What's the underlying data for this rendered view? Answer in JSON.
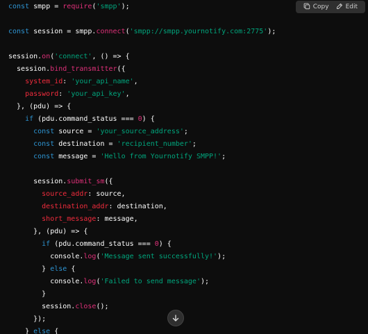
{
  "toolbar": {
    "copy_label": "Copy",
    "edit_label": "Edit"
  },
  "code_lines": [
    [
      [
        "kw",
        "const"
      ],
      [
        "pl",
        " smpp = "
      ],
      [
        "fn",
        "require"
      ],
      [
        "pl",
        "("
      ],
      [
        "str",
        "'smpp'"
      ],
      [
        "pl",
        ");"
      ]
    ],
    [],
    [
      [
        "kw",
        "const"
      ],
      [
        "pl",
        " session = smpp."
      ],
      [
        "fn",
        "connect"
      ],
      [
        "pl",
        "("
      ],
      [
        "str",
        "'smpp://smpp.yournotify.com:2775'"
      ],
      [
        "pl",
        ");"
      ]
    ],
    [],
    [
      [
        "pl",
        "session."
      ],
      [
        "fn",
        "on"
      ],
      [
        "pl",
        "("
      ],
      [
        "str",
        "'connect'"
      ],
      [
        "pl",
        ", () => {"
      ]
    ],
    [
      [
        "pl",
        "  session."
      ],
      [
        "fn",
        "bind_transmitter"
      ],
      [
        "pl",
        "({"
      ]
    ],
    [
      [
        "prop",
        "    system_id"
      ],
      [
        "pl",
        ": "
      ],
      [
        "str",
        "'your_api_name'"
      ],
      [
        "pl",
        ","
      ]
    ],
    [
      [
        "prop",
        "    password"
      ],
      [
        "pl",
        ": "
      ],
      [
        "str",
        "'your_api_key'"
      ],
      [
        "pl",
        ","
      ]
    ],
    [
      [
        "pl",
        "  }, (pdu) => {"
      ]
    ],
    [
      [
        "kw",
        "    if"
      ],
      [
        "pl",
        " (pdu.command_status === "
      ],
      [
        "num",
        "0"
      ],
      [
        "pl",
        ") {"
      ]
    ],
    [
      [
        "kw",
        "      const"
      ],
      [
        "pl",
        " source = "
      ],
      [
        "str",
        "'your_source_address'"
      ],
      [
        "pl",
        ";"
      ]
    ],
    [
      [
        "kw",
        "      const"
      ],
      [
        "pl",
        " destination = "
      ],
      [
        "str",
        "'recipient_number'"
      ],
      [
        "pl",
        ";"
      ]
    ],
    [
      [
        "kw",
        "      const"
      ],
      [
        "pl",
        " message = "
      ],
      [
        "str",
        "'Hello from Yournotify SMPP!'"
      ],
      [
        "pl",
        ";"
      ]
    ],
    [],
    [
      [
        "pl",
        "      session."
      ],
      [
        "fn",
        "submit_sm"
      ],
      [
        "pl",
        "({"
      ]
    ],
    [
      [
        "prop",
        "        source_addr"
      ],
      [
        "pl",
        ": source,"
      ]
    ],
    [
      [
        "prop",
        "        destination_addr"
      ],
      [
        "pl",
        ": destination,"
      ]
    ],
    [
      [
        "prop",
        "        short_message"
      ],
      [
        "pl",
        ": message,"
      ]
    ],
    [
      [
        "pl",
        "      }, (pdu) => {"
      ]
    ],
    [
      [
        "kw",
        "        if"
      ],
      [
        "pl",
        " (pdu.command_status === "
      ],
      [
        "num",
        "0"
      ],
      [
        "pl",
        ") {"
      ]
    ],
    [
      [
        "pl",
        "          console."
      ],
      [
        "fn",
        "log"
      ],
      [
        "pl",
        "("
      ],
      [
        "str",
        "'Message sent successfully!'"
      ],
      [
        "pl",
        ");"
      ]
    ],
    [
      [
        "pl",
        "        } "
      ],
      [
        "kw",
        "else"
      ],
      [
        "pl",
        " {"
      ]
    ],
    [
      [
        "pl",
        "          console."
      ],
      [
        "fn",
        "log"
      ],
      [
        "pl",
        "("
      ],
      [
        "str",
        "'Failed to send message'"
      ],
      [
        "pl",
        ");"
      ]
    ],
    [
      [
        "pl",
        "        }"
      ]
    ],
    [
      [
        "pl",
        "        session."
      ],
      [
        "fn",
        "close"
      ],
      [
        "pl",
        "();"
      ]
    ],
    [
      [
        "pl",
        "      });"
      ]
    ],
    [
      [
        "pl",
        "    } "
      ],
      [
        "kw",
        "else"
      ],
      [
        "pl",
        " {"
      ]
    ]
  ],
  "icons": {
    "copy": "copy-icon",
    "edit": "edit-icon",
    "scroll": "arrow-down-icon"
  },
  "colors": {
    "background": "#0d0d0d",
    "keyword": "#2e95d3",
    "string": "#00a67d",
    "function": "#df3079",
    "property": "#f22c3d"
  }
}
